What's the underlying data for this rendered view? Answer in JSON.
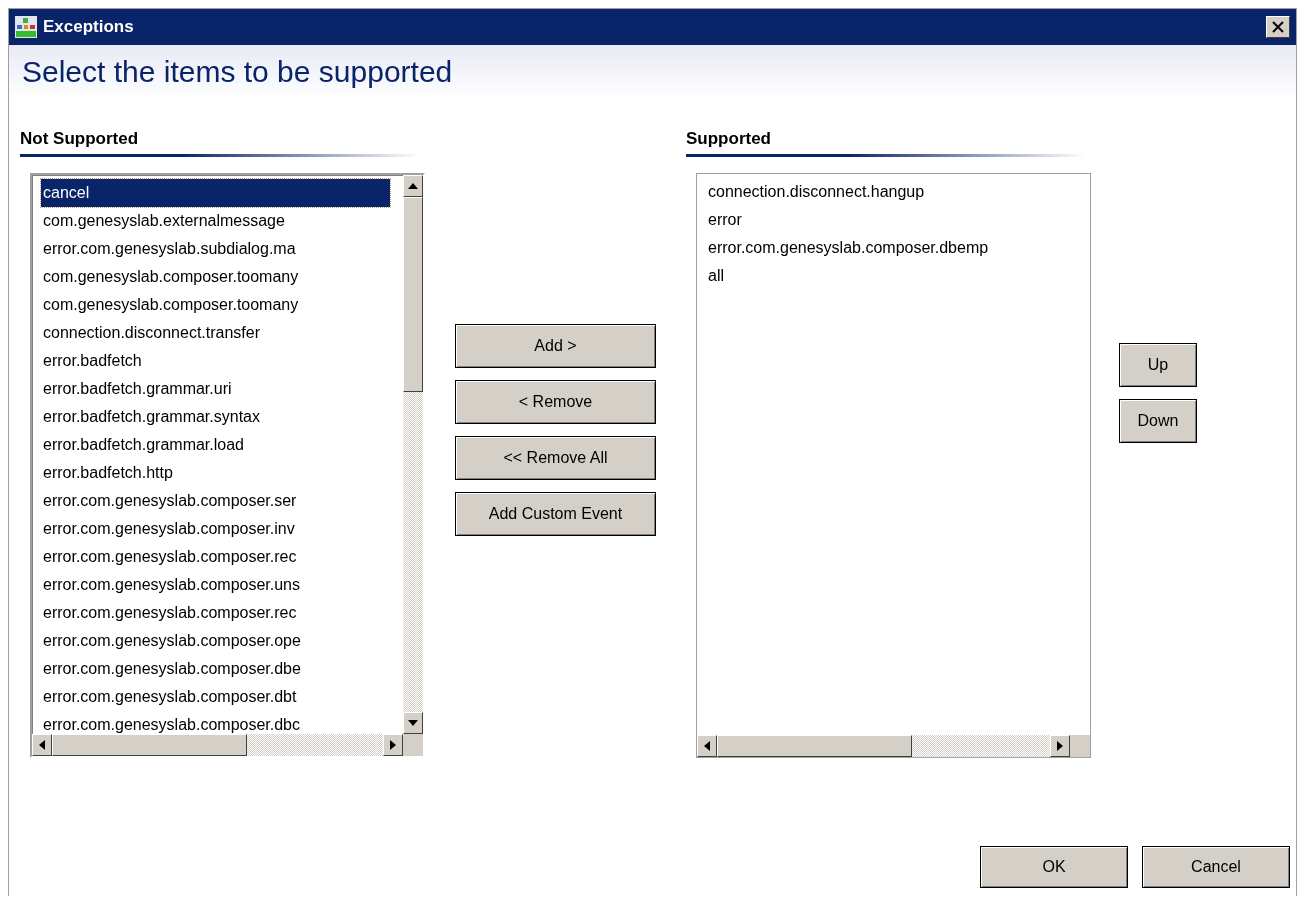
{
  "window": {
    "title": "Exceptions"
  },
  "heading": "Select the items to be supported",
  "not_supported": {
    "label": "Not Supported",
    "items": [
      {
        "text": "cancel",
        "selected": true
      },
      {
        "text": "com.genesyslab.externalmessage",
        "selected": false
      },
      {
        "text": "error.com.genesyslab.subdialog.ma",
        "selected": false
      },
      {
        "text": "com.genesyslab.composer.toomany",
        "selected": false
      },
      {
        "text": "com.genesyslab.composer.toomany",
        "selected": false
      },
      {
        "text": "connection.disconnect.transfer",
        "selected": false
      },
      {
        "text": "error.badfetch",
        "selected": false
      },
      {
        "text": "error.badfetch.grammar.uri",
        "selected": false
      },
      {
        "text": "error.badfetch.grammar.syntax",
        "selected": false
      },
      {
        "text": "error.badfetch.grammar.load",
        "selected": false
      },
      {
        "text": "error.badfetch.http",
        "selected": false
      },
      {
        "text": "error.com.genesyslab.composer.ser",
        "selected": false
      },
      {
        "text": "error.com.genesyslab.composer.inv",
        "selected": false
      },
      {
        "text": "error.com.genesyslab.composer.rec",
        "selected": false
      },
      {
        "text": "error.com.genesyslab.composer.uns",
        "selected": false
      },
      {
        "text": "error.com.genesyslab.composer.rec",
        "selected": false
      },
      {
        "text": "error.com.genesyslab.composer.ope",
        "selected": false
      },
      {
        "text": "error.com.genesyslab.composer.dbe",
        "selected": false
      },
      {
        "text": "error.com.genesyslab.composer.dbt",
        "selected": false
      },
      {
        "text": "error.com.genesyslab.composer.dbc",
        "selected": false
      }
    ]
  },
  "transfer_buttons": [
    "Add >",
    "< Remove",
    "<< Remove All",
    "Add Custom Event"
  ],
  "supported": {
    "label": "Supported",
    "items": [
      {
        "text": "connection.disconnect.hangup",
        "selected": false
      },
      {
        "text": "error",
        "selected": false
      },
      {
        "text": "error.com.genesyslab.composer.dbemp",
        "selected": false
      },
      {
        "text": "all",
        "selected": false
      }
    ]
  },
  "order_buttons": [
    "Up",
    "Down"
  ],
  "footer_buttons": [
    "OK",
    "Cancel"
  ]
}
